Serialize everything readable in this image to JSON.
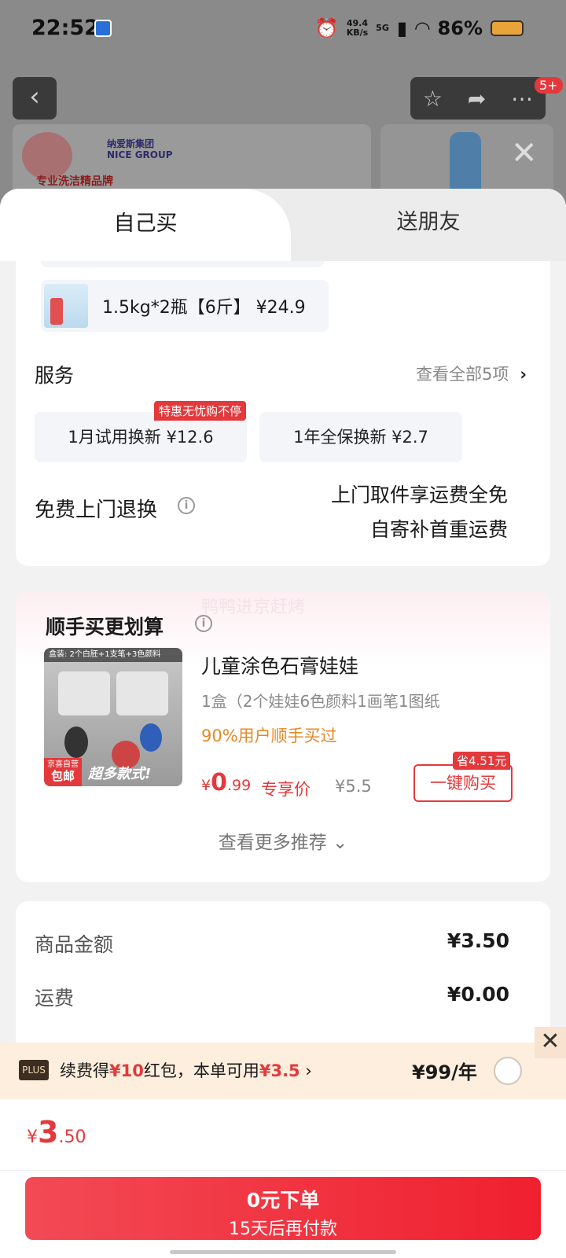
{
  "status_bar": {
    "time": "22:52",
    "net_speed_value": "49.4",
    "net_speed_unit": "KB/s",
    "network": "5G",
    "battery": "86%"
  },
  "background": {
    "brand_cn": "纳爱斯集团",
    "brand_en": "NICE GROUP",
    "slogan": "专业洗洁精品牌",
    "notification_count": "5+"
  },
  "tabs": {
    "self": "自己买",
    "friend": "送朋友"
  },
  "spec": {
    "label": "1.5kg*2瓶【6斤】 ¥24.9"
  },
  "service": {
    "title": "服务",
    "more": "查看全部5项",
    "options": [
      {
        "label": "1月试用换新 ¥12.6",
        "tag": "特惠无忧购不停"
      },
      {
        "label": "1年全保换新 ¥2.7"
      }
    ],
    "return_title": "免费上门退换",
    "return_line1": "上门取件享运费全免",
    "return_line2": "自寄补首重运费"
  },
  "upsell": {
    "watermark": "鸭鸭进京赶烤",
    "title": "顺手买更划算",
    "image_top_label": "盒装: 2个白胚+1支笔+3色颜料",
    "image_tag_top": "京喜自营",
    "image_tag_bottom": "包邮",
    "image_slogan": "超多款式!",
    "product_name": "儿童涂色石膏娃娃",
    "product_desc": "1盒（2个娃娃6色颜料1画笔1图纸",
    "bought": "90%用户顺手买过",
    "price_symbol": "¥",
    "price_int": "0",
    "price_dec": ".99",
    "price_label": "专享价",
    "orig_price": "¥5.5",
    "save_tag": "省4.51元",
    "buy_button": "一键购买",
    "more": "查看更多推荐"
  },
  "summary": {
    "rows": [
      {
        "label": "商品金额",
        "value": "¥3.50"
      },
      {
        "label": "运费",
        "value": "¥0.00"
      }
    ]
  },
  "plus": {
    "logo": "PLUS",
    "text_prefix": "续费得",
    "red1": "¥10",
    "text_mid": "红包，本单可用",
    "red2": "¥3.5",
    "price": "¥99/年"
  },
  "total": {
    "symbol": "¥",
    "int": "3",
    "dec": ".50"
  },
  "submit": {
    "main": "0元下单",
    "sub": "15天后再付款"
  },
  "colors": {
    "accent": "#e4393c",
    "plus_bg": "#fdeedd",
    "orange": "#e38a26"
  }
}
